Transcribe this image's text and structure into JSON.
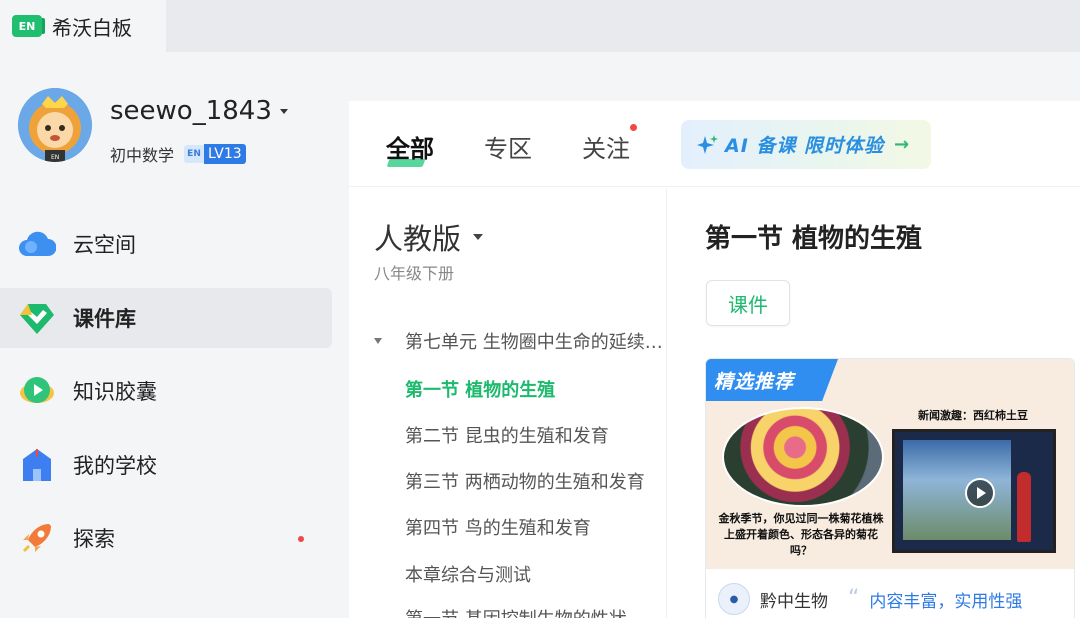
{
  "app": {
    "logo_text": "EN",
    "name": "希沃白板"
  },
  "profile": {
    "username": "seewo_1843",
    "subject": "初中数学",
    "level_icon": "EN",
    "level": "LV13"
  },
  "sidebar": {
    "items": [
      {
        "label": "云空间",
        "icon": "cloud-icon",
        "active": false
      },
      {
        "label": "课件库",
        "icon": "courseware-library-icon",
        "active": true
      },
      {
        "label": "知识胶囊",
        "icon": "knowledge-capsule-icon",
        "active": false
      },
      {
        "label": "我的学校",
        "icon": "school-icon",
        "active": false
      },
      {
        "label": "探索",
        "icon": "rocket-icon",
        "active": false,
        "has_dot": true
      }
    ]
  },
  "tabs": [
    {
      "label": "全部",
      "active": true
    },
    {
      "label": "专区",
      "active": false
    },
    {
      "label": "关注",
      "active": false,
      "has_dot": true
    }
  ],
  "ai_button": {
    "label": "AI 备课 限时体验",
    "arrow": "→"
  },
  "catalog": {
    "edition": "人教版",
    "grade": "八年级下册",
    "unit": "第七单元 生物圈中生命的延续和发展",
    "sections": [
      {
        "label": "第一节 植物的生殖",
        "active": true
      },
      {
        "label": "第二节 昆虫的生殖和发育",
        "active": false
      },
      {
        "label": "第三节 两栖动物的生殖和发育",
        "active": false
      },
      {
        "label": "第四节 鸟的生殖和发育",
        "active": false
      },
      {
        "label": "本章综合与测试",
        "active": false
      },
      {
        "label": "第一节 基因控制生物的性状",
        "active": false
      }
    ]
  },
  "detail": {
    "title": "第一节 植物的生殖",
    "tag": "课件",
    "card": {
      "ribbon": "精选推荐",
      "news_title": "新闻激趣：西红柿土豆",
      "photo_caption": "金秋季节，你见过同一株菊花植株上盛开着颜色、形态各异的菊花吗？",
      "publisher": "黔中生物",
      "quote_mark": "“",
      "slogan": "内容丰富，实用性强"
    }
  },
  "colors": {
    "accent": "#1dba6e",
    "brand_blue": "#2f7be6",
    "notification": "#f04848"
  }
}
